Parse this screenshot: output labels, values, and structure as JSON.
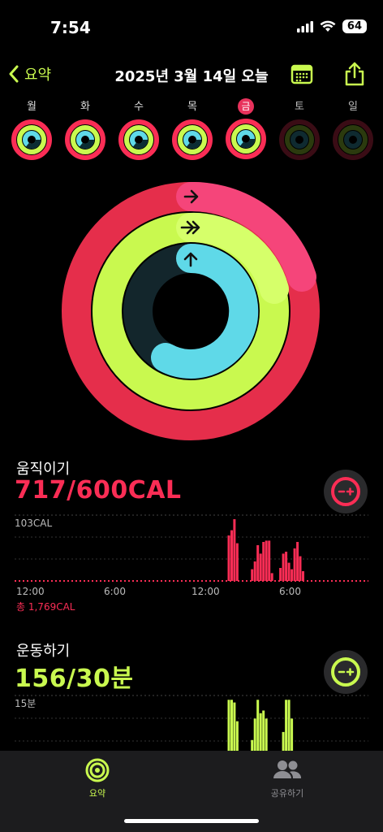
{
  "status": {
    "time": "7:54",
    "battery": "64"
  },
  "nav": {
    "back_label": "요약",
    "title": "2025년 3월 14일 오늘"
  },
  "week": {
    "days": [
      {
        "label": "월",
        "state": "past"
      },
      {
        "label": "화",
        "state": "past"
      },
      {
        "label": "수",
        "state": "past"
      },
      {
        "label": "목",
        "state": "past"
      },
      {
        "label": "금",
        "state": "today"
      },
      {
        "label": "토",
        "state": "future"
      },
      {
        "label": "일",
        "state": "future"
      }
    ]
  },
  "rings": {
    "move_progress": 1.195,
    "exercise_progress": 5.2,
    "stand_progress": 0.6
  },
  "move": {
    "title": "움직이기",
    "value": "717/600CAL",
    "ymax_label": "103CAL",
    "xticks": [
      "12:00",
      "6:00",
      "12:00",
      "6:00"
    ],
    "total": "총 1,769CAL",
    "color": "#fa2d55",
    "bars": [
      0,
      0,
      0,
      0,
      0,
      0,
      0,
      0,
      0,
      0,
      0,
      0,
      0,
      0,
      0,
      0,
      0,
      0,
      0,
      0,
      0,
      0,
      0,
      0,
      0,
      0,
      0,
      0,
      0,
      0,
      0,
      0,
      0,
      0,
      0,
      0,
      0,
      0,
      0,
      0,
      0,
      0,
      0,
      0,
      0,
      0,
      0,
      0,
      0,
      0,
      0,
      0,
      0,
      0,
      0,
      0,
      0,
      0,
      0,
      0,
      0,
      0,
      0,
      0,
      0,
      0,
      0,
      0,
      0,
      0,
      0,
      0,
      0,
      0,
      0,
      0,
      0,
      0,
      0,
      0,
      0,
      0,
      0,
      0,
      0,
      0,
      0,
      0,
      0,
      0,
      0,
      0,
      0,
      0,
      0,
      0,
      0,
      0,
      0,
      0,
      0,
      0,
      0,
      0,
      0,
      0,
      0,
      0,
      0,
      0,
      0,
      0,
      0,
      0,
      0,
      0,
      0,
      0,
      0,
      0,
      0,
      0,
      0,
      0,
      0,
      0,
      0,
      0,
      0,
      0,
      0,
      0,
      0,
      0,
      0,
      0,
      0,
      0,
      0,
      0,
      0,
      0,
      0,
      0,
      0,
      0,
      0,
      0,
      0,
      0,
      0,
      0,
      0,
      0,
      0,
      0,
      0,
      0,
      0,
      0,
      0,
      0,
      0,
      0,
      0,
      0,
      0,
      0,
      0,
      0,
      0,
      0,
      0,
      0,
      0,
      0,
      0,
      0,
      0,
      0,
      0,
      0,
      0,
      0,
      0,
      0,
      0,
      0,
      0,
      0,
      0,
      0,
      0,
      0,
      0,
      0,
      0,
      0,
      0,
      0,
      0,
      0,
      0,
      0,
      0,
      0,
      0,
      0,
      0,
      0,
      0,
      0,
      0,
      0,
      0,
      0,
      0,
      0,
      0,
      0,
      0,
      0,
      0,
      0,
      0,
      0,
      0,
      0,
      0,
      0,
      0,
      0,
      0,
      0,
      0,
      0,
      0,
      0,
      0,
      0,
      0,
      0,
      0,
      0,
      0,
      0,
      0,
      0,
      0,
      0,
      0,
      0,
      0,
      0,
      0,
      0,
      0,
      0,
      0,
      0,
      0,
      0,
      0,
      0,
      0,
      0,
      0,
      0,
      0,
      0,
      0,
      0,
      0,
      0,
      0,
      0,
      0,
      0,
      0,
      0,
      0,
      0,
      0,
      0,
      0,
      0,
      0,
      0,
      0,
      0,
      0,
      0,
      0,
      0,
      0,
      0,
      0,
      0,
      0,
      0,
      0,
      0,
      0,
      0,
      0,
      0,
      0,
      0,
      0,
      0
    ]
  },
  "move_chart": {
    "bars": [
      {
        "t": 0.602,
        "v": 0.7
      },
      {
        "t": 0.61,
        "v": 0.78
      },
      {
        "t": 0.618,
        "v": 0.95
      },
      {
        "t": 0.626,
        "v": 0.58
      },
      {
        "t": 0.668,
        "v": 0.18
      },
      {
        "t": 0.676,
        "v": 0.3
      },
      {
        "t": 0.684,
        "v": 0.55
      },
      {
        "t": 0.692,
        "v": 0.42
      },
      {
        "t": 0.7,
        "v": 0.6
      },
      {
        "t": 0.708,
        "v": 0.62
      },
      {
        "t": 0.716,
        "v": 0.62
      },
      {
        "t": 0.724,
        "v": 0.12
      },
      {
        "t": 0.748,
        "v": 0.2
      },
      {
        "t": 0.756,
        "v": 0.42
      },
      {
        "t": 0.764,
        "v": 0.45
      },
      {
        "t": 0.772,
        "v": 0.28
      },
      {
        "t": 0.78,
        "v": 0.18
      },
      {
        "t": 0.788,
        "v": 0.5
      },
      {
        "t": 0.796,
        "v": 0.6
      },
      {
        "t": 0.804,
        "v": 0.38
      },
      {
        "t": 0.812,
        "v": 0.15
      }
    ]
  },
  "exercise": {
    "title": "운동하기",
    "value": "156/30분",
    "ymax_label": "15분",
    "color": "#c9f94f",
    "bars": [
      {
        "t": 0.602,
        "v": 0.95
      },
      {
        "t": 0.61,
        "v": 0.95
      },
      {
        "t": 0.618,
        "v": 0.9
      },
      {
        "t": 0.626,
        "v": 0.55
      },
      {
        "t": 0.668,
        "v": 0.2
      },
      {
        "t": 0.676,
        "v": 0.6
      },
      {
        "t": 0.684,
        "v": 0.95
      },
      {
        "t": 0.692,
        "v": 0.7
      },
      {
        "t": 0.7,
        "v": 0.75
      },
      {
        "t": 0.708,
        "v": 0.6
      },
      {
        "t": 0.756,
        "v": 0.35
      },
      {
        "t": 0.764,
        "v": 0.95
      },
      {
        "t": 0.772,
        "v": 0.95
      },
      {
        "t": 0.78,
        "v": 0.6
      }
    ]
  },
  "tabs": [
    {
      "label": "요약",
      "active": true
    },
    {
      "label": "공유하기",
      "active": false
    }
  ],
  "colors": {
    "move": "#fa2d55",
    "exercise": "#c9f94f",
    "stand": "#5fd9e8",
    "accent": "#c9f94f"
  },
  "icons": {
    "back": "chevron-left-icon",
    "calendar": "calendar-icon",
    "share": "share-icon"
  }
}
